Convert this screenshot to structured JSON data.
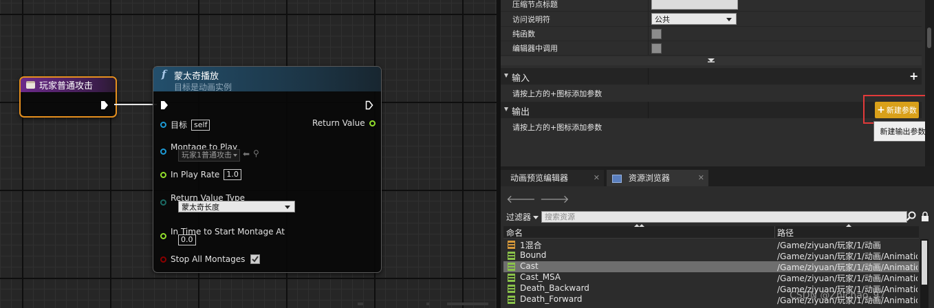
{
  "graph": {
    "event_node": {
      "title": "玩家普通攻击"
    },
    "function_node": {
      "icon": "f",
      "title": "蒙太奇播放",
      "subtitle": "目标是动画实例",
      "pins": {
        "target_label": "目标",
        "target_value": "self",
        "return_value_label": "Return Value",
        "montage_label": "Montage to Play",
        "montage_value": "玩家1普通攻击",
        "play_rate_label": "In Play Rate",
        "play_rate_value": "1.0",
        "return_type_label": "Return Value Type",
        "return_type_value": "蒙太奇长度",
        "start_time_label": "In Time to Start Montage At",
        "start_time_value": "0.0",
        "stop_all_label": "Stop All Montages",
        "stop_all_checked": true
      }
    }
  },
  "details": {
    "rows": {
      "compress_title": "压缩节点标题",
      "access_label": "访问说明符",
      "access_value": "公共",
      "pure_label": "纯函数",
      "editor_call_label": "编辑器中调用"
    },
    "inputs": {
      "label": "输入",
      "hint": "请按上方的+图标添加参数"
    },
    "outputs": {
      "label": "输出",
      "hint": "请按上方的+图标添加参数"
    },
    "new_param_button": "新建参数",
    "tooltip": "新建输出参数"
  },
  "bottom_panel": {
    "tabs": [
      "动画预览编辑器",
      "资源浏览器"
    ],
    "close_glyph": "✕",
    "filter_label": "过滤器",
    "search_placeholder": "搜索资源",
    "columns": {
      "name": "命名",
      "path": "路径"
    },
    "assets": [
      {
        "name": "1混合",
        "path": "/Game/ziyuan/玩家/1/动画",
        "icon_color": "#d89a3a",
        "selected": false
      },
      {
        "name": "Bound",
        "path": "/Game/ziyuan/玩家/1/动画/Animatio",
        "icon_color": "#8bc34a",
        "selected": false
      },
      {
        "name": "Cast",
        "path": "/Game/ziyuan/玩家/1/动画/Animatio",
        "icon_color": "#8bc34a",
        "selected": true
      },
      {
        "name": "Cast_MSA",
        "path": "/Game/ziyuan/玩家/1/动画/Animatio",
        "icon_color": "#8bc34a",
        "selected": false
      },
      {
        "name": "Death_Backward",
        "path": "/Game/ziyuan/玩家/1/动画/Animatio",
        "icon_color": "#8bc34a",
        "selected": false
      },
      {
        "name": "Death_Forward",
        "path": "/Game/ziyuan/玩家/1/动画/Animatio",
        "icon_color": "#8bc34a",
        "selected": false
      }
    ]
  },
  "watermark": "CSDN @Zhichao_97",
  "colors": {
    "accent_orange": "#e6901e",
    "exec_pin": "#ffffff",
    "object_pin": "#1d9bd6",
    "float_pin": "#93e02c",
    "enum_pin": "#1b6b64",
    "bool_pin": "#8b0000",
    "highlight_red": "#e23a3a",
    "button_gold": "#d9a01a"
  }
}
